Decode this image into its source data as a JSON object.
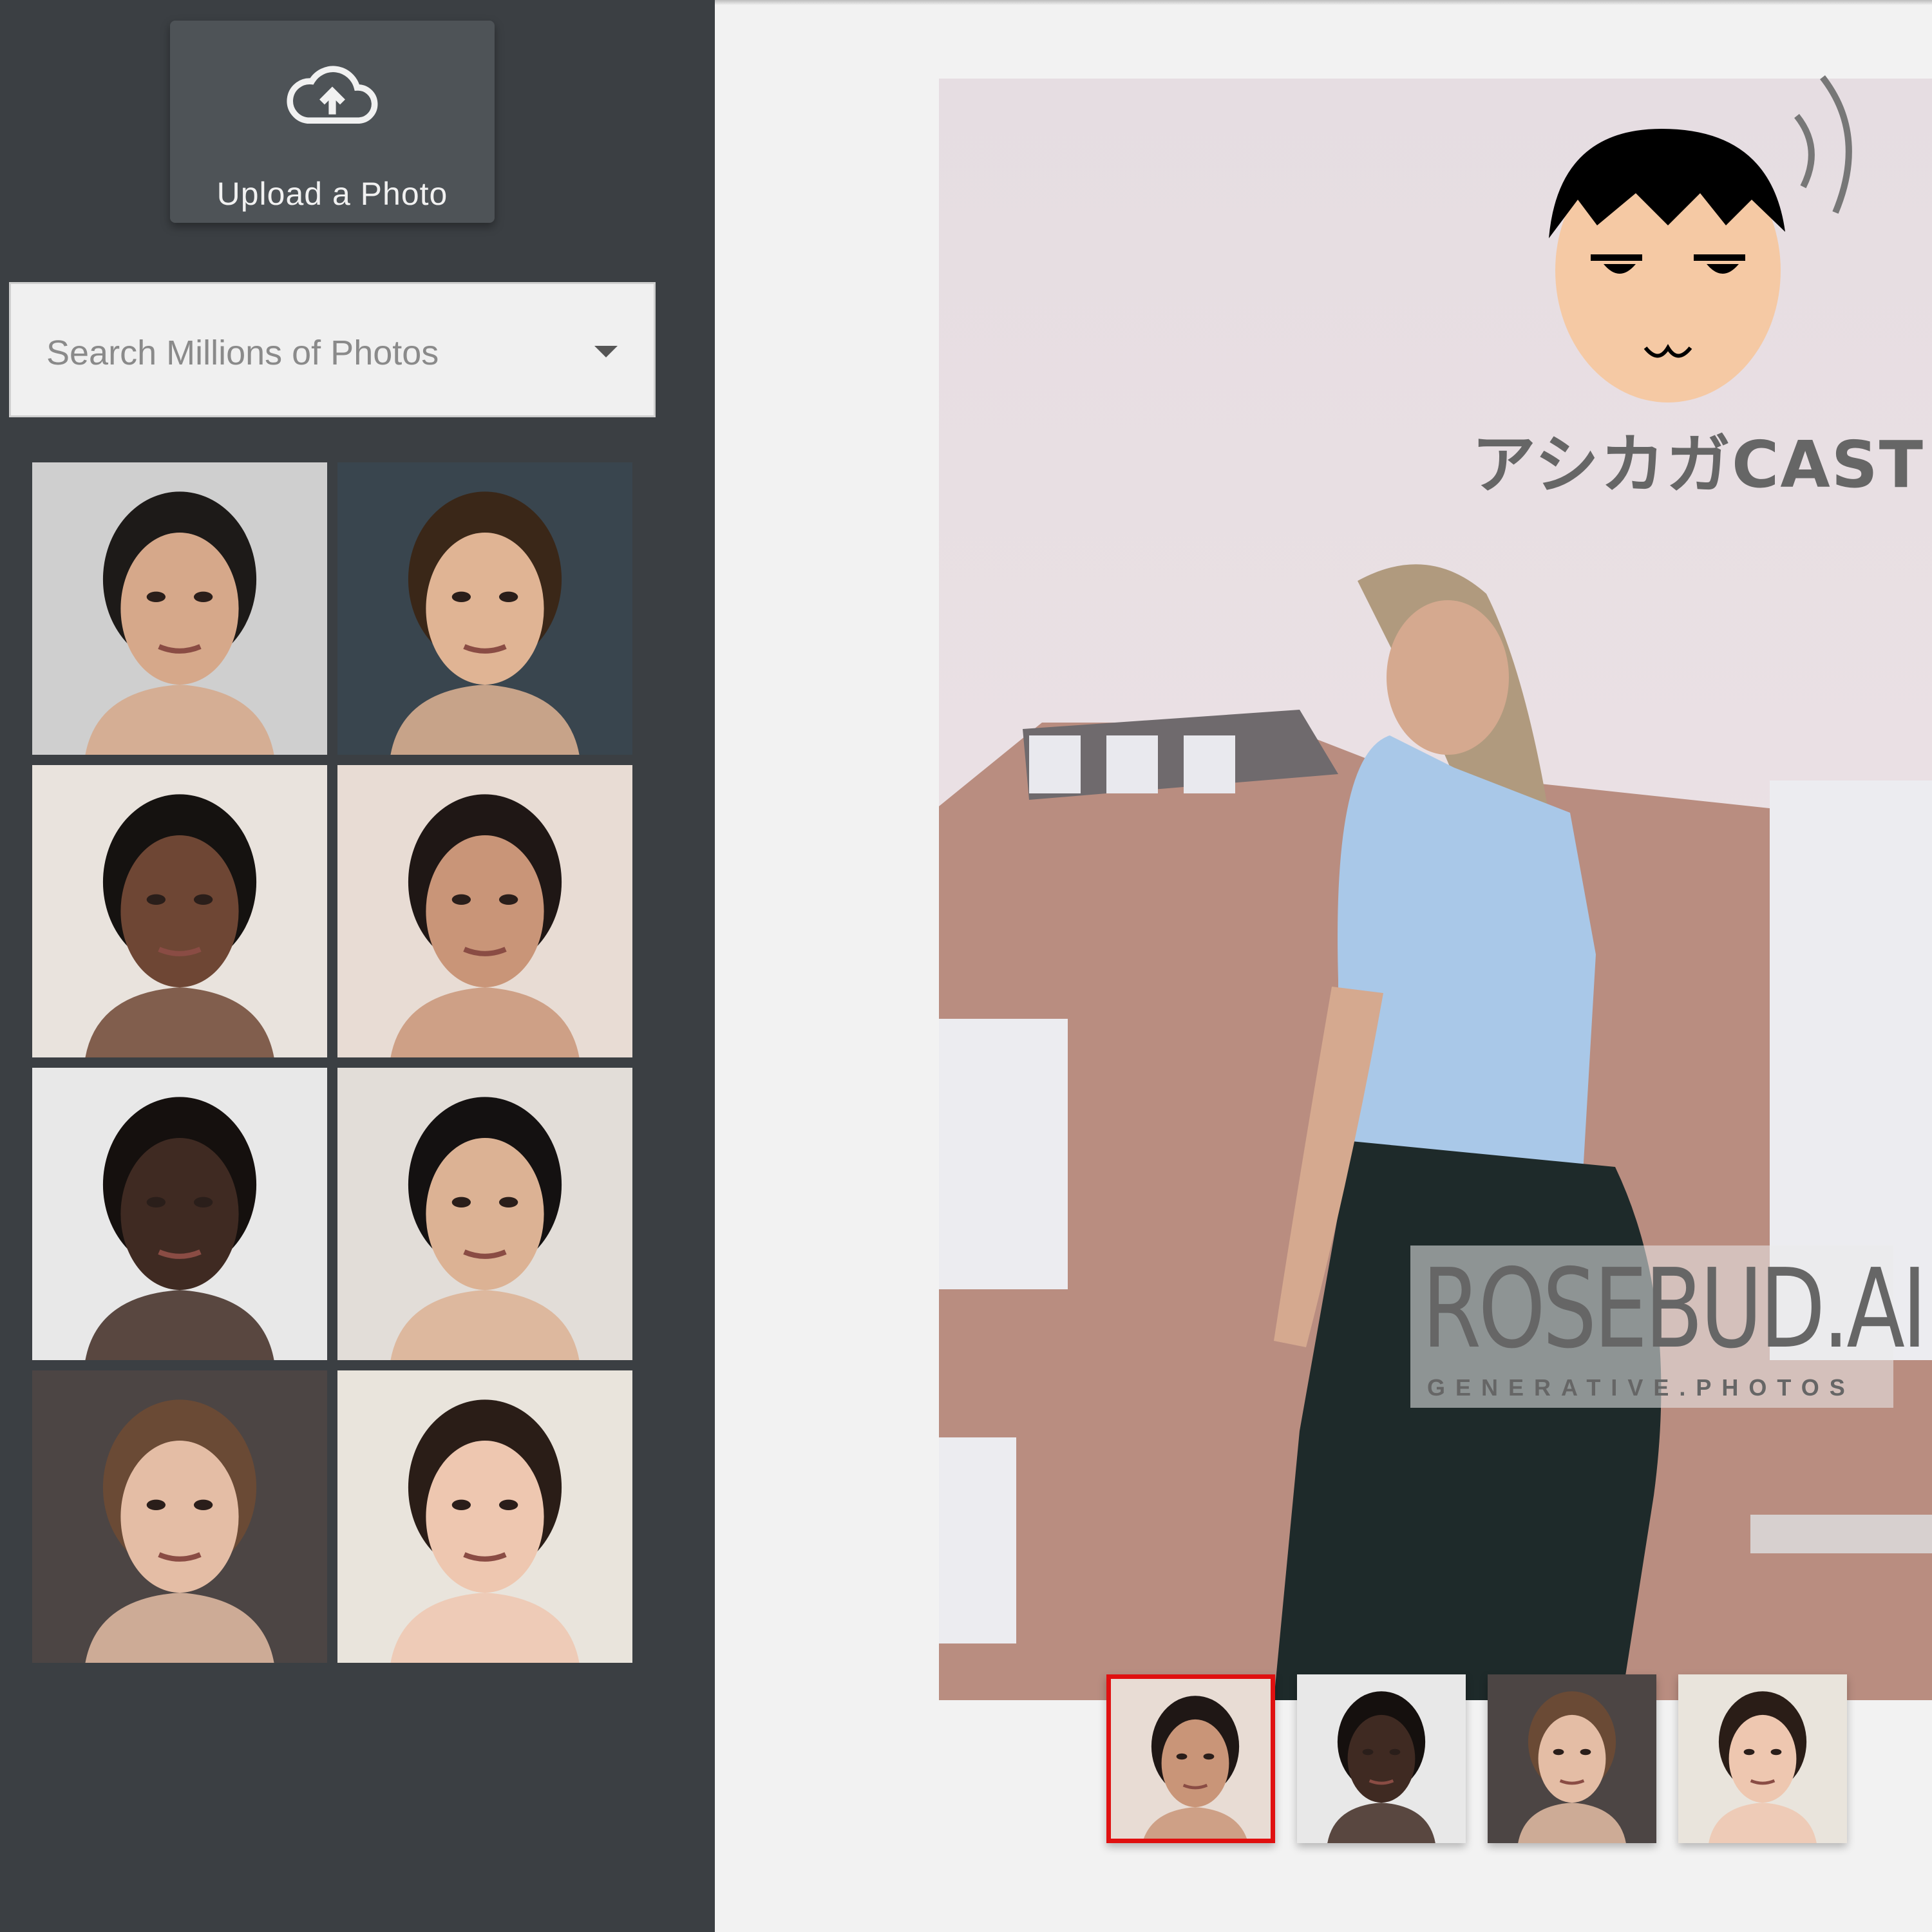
{
  "sidebar": {
    "upload_label": "Upload a Photo",
    "search_placeholder": "Search Millions of Photos",
    "faces": [
      {
        "name": "face-1",
        "bg": "#cfcfcf",
        "skin": "#d6a88a",
        "hair": "#1d1a18"
      },
      {
        "name": "face-2",
        "bg": "#39454e",
        "skin": "#e0b494",
        "hair": "#3a2718"
      },
      {
        "name": "face-3",
        "bg": "#e9e3dd",
        "skin": "#6e4634",
        "hair": "#151210"
      },
      {
        "name": "face-4",
        "bg": "#e8dcd4",
        "skin": "#c99578",
        "hair": "#1f1715"
      },
      {
        "name": "face-5",
        "bg": "#e8e8e8",
        "skin": "#3f2a22",
        "hair": "#15100e"
      },
      {
        "name": "face-6",
        "bg": "#e2ddd8",
        "skin": "#dcb294",
        "hair": "#141111"
      },
      {
        "name": "face-7",
        "bg": "#4c4544",
        "skin": "#e4bda5",
        "hair": "#6a4a35"
      },
      {
        "name": "face-8",
        "bg": "#e9e4dc",
        "skin": "#eec7b0",
        "hair": "#2a1d17"
      }
    ]
  },
  "main": {
    "watermark_brand": "ROSEBUD.AI",
    "watermark_tagline": "GENERATIVE.PHOTOS",
    "mascot_text": "アシカガCAST",
    "thumbnails": [
      {
        "name": "thumb-1",
        "bg": "#e8dcd4",
        "skin": "#c99578",
        "hair": "#1f1715",
        "selected": true
      },
      {
        "name": "thumb-2",
        "bg": "#e8e8e8",
        "skin": "#3f2a22",
        "hair": "#15100e",
        "selected": false
      },
      {
        "name": "thumb-3",
        "bg": "#4c4544",
        "skin": "#e4bda5",
        "hair": "#6a4a35",
        "selected": false
      },
      {
        "name": "thumb-4",
        "bg": "#e9e4dc",
        "skin": "#eec7b0",
        "hair": "#2a1d17",
        "selected": false
      }
    ]
  },
  "colors": {
    "sidebar_bg": "#3b3f43",
    "selected_border": "#e01010",
    "main_bg": "#f2f2f2"
  }
}
